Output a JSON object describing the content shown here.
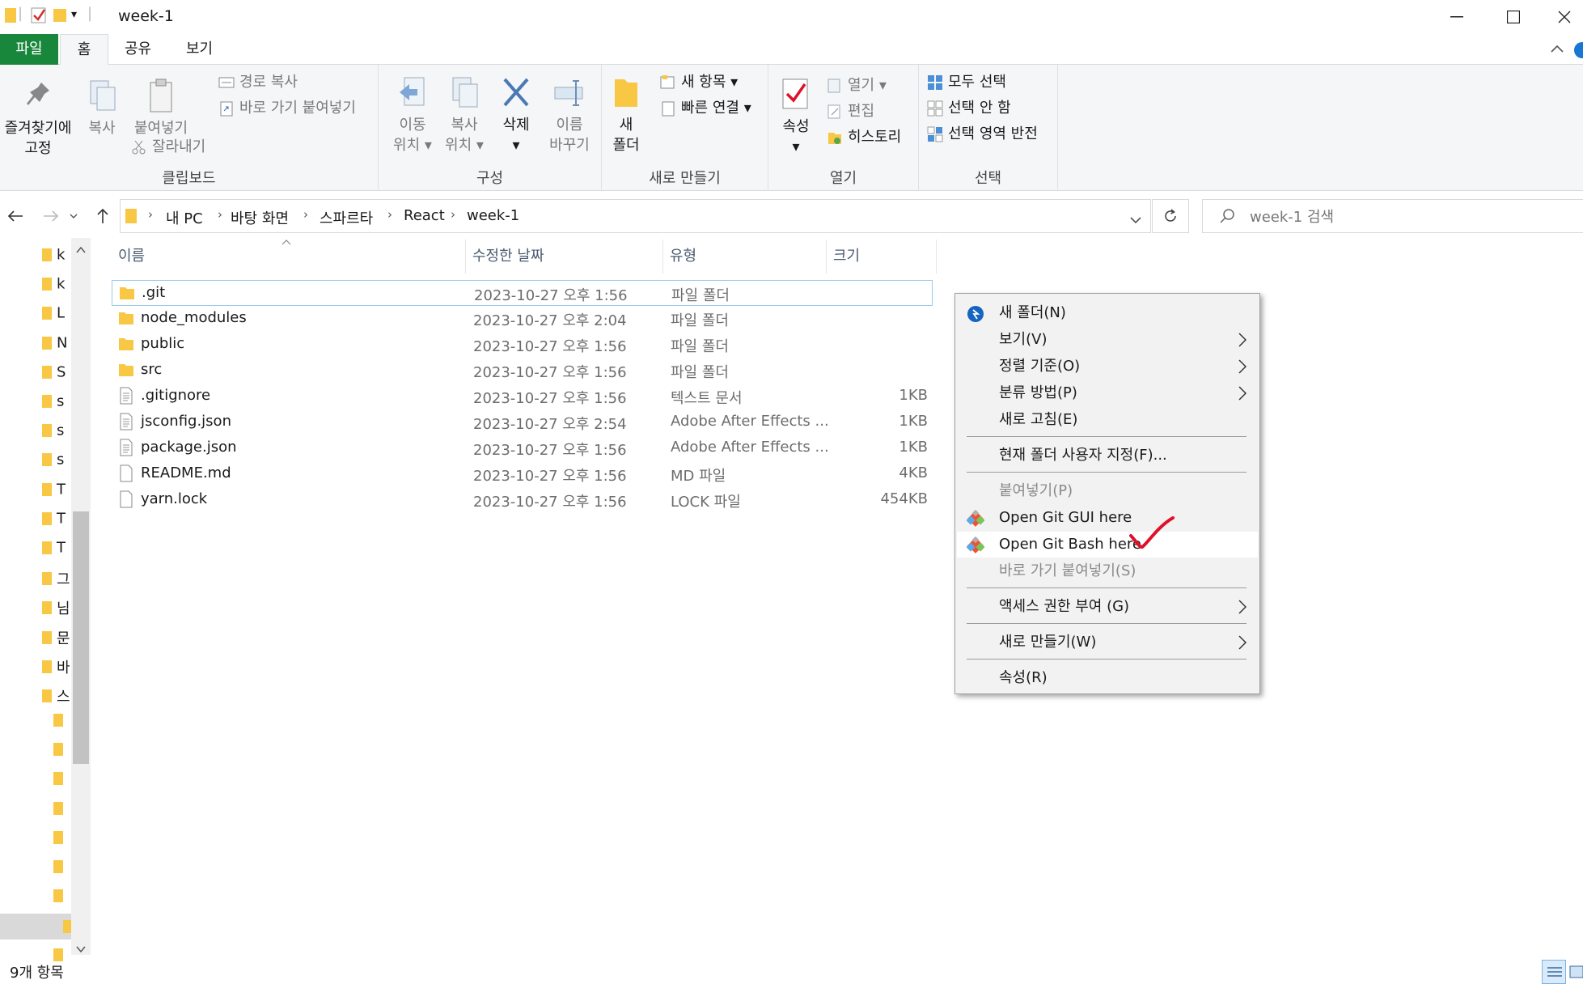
{
  "window": {
    "title": "week-1",
    "quick_access_chevron": "▾"
  },
  "ribbon_tabs": [
    "파일",
    "홈",
    "공유",
    "보기"
  ],
  "ribbon": {
    "clipboard": {
      "label": "클립보드",
      "pin_line1": "즐겨찾기에",
      "pin_line2": "고정",
      "copy": "복사",
      "paste": "붙여넣기",
      "copy_path": "경로 복사",
      "paste_shortcut": "바로 가기 붙여넣기",
      "cut": "잘라내기"
    },
    "organize": {
      "label": "구성",
      "move_line1": "이동",
      "move_line2": "위치",
      "copy_line1": "복사",
      "copy_line2": "위치",
      "delete": "삭제",
      "rename_line1": "이름",
      "rename_line2": "바꾸기"
    },
    "new": {
      "label": "새로 만들기",
      "new_folder_line1": "새",
      "new_folder_line2": "폴더",
      "new_item": "새 항목",
      "easy_access": "빠른 연결"
    },
    "open": {
      "label": "열기",
      "properties": "속성",
      "open": "열기",
      "edit": "편집",
      "history": "히스토리"
    },
    "select": {
      "label": "선택",
      "select_all": "모두 선택",
      "select_none": "선택 안 함",
      "invert": "선택 영역 반전"
    }
  },
  "address": {
    "crumbs": [
      "내 PC",
      "바탕 화면",
      "스파르타",
      "React",
      "week-1"
    ],
    "search_placeholder": "week-1 검색"
  },
  "nav_pane": {
    "items": [
      "k",
      "k",
      "L",
      "N",
      "S",
      "s",
      "s",
      "s",
      "T",
      "T",
      "T",
      "그",
      "님",
      "문",
      "바",
      "스"
    ]
  },
  "file_list": {
    "columns": [
      "이름",
      "수정한 날짜",
      "유형",
      "크기"
    ],
    "rows": [
      {
        "name": ".git",
        "date": "2023-10-27 오후 1:56",
        "type": "파일 폴더",
        "size": "",
        "kind": "folder"
      },
      {
        "name": "node_modules",
        "date": "2023-10-27 오후 2:04",
        "type": "파일 폴더",
        "size": "",
        "kind": "folder"
      },
      {
        "name": "public",
        "date": "2023-10-27 오후 1:56",
        "type": "파일 폴더",
        "size": "",
        "kind": "folder"
      },
      {
        "name": "src",
        "date": "2023-10-27 오후 1:56",
        "type": "파일 폴더",
        "size": "",
        "kind": "folder"
      },
      {
        "name": ".gitignore",
        "date": "2023-10-27 오후 1:56",
        "type": "텍스트 문서",
        "size": "1KB",
        "kind": "text"
      },
      {
        "name": "jsconfig.json",
        "date": "2023-10-27 오후 2:54",
        "type": "Adobe After Effects ...",
        "size": "1KB",
        "kind": "text"
      },
      {
        "name": "package.json",
        "date": "2023-10-27 오후 1:56",
        "type": "Adobe After Effects ...",
        "size": "1KB",
        "kind": "text"
      },
      {
        "name": "README.md",
        "date": "2023-10-27 오후 1:56",
        "type": "MD 파일",
        "size": "4KB",
        "kind": "file"
      },
      {
        "name": "yarn.lock",
        "date": "2023-10-27 오후 1:56",
        "type": "LOCK 파일",
        "size": "454KB",
        "kind": "file"
      }
    ]
  },
  "context_menu": {
    "items": [
      {
        "label": "새 폴더(N)",
        "icon": "new-folder-shortcut-icon",
        "arrow": false,
        "dim": false
      },
      {
        "label": "보기(V)",
        "arrow": true,
        "dim": false
      },
      {
        "label": "정렬 기준(O)",
        "arrow": true,
        "dim": false
      },
      {
        "label": "분류 방법(P)",
        "arrow": true,
        "dim": false
      },
      {
        "label": "새로 고침(E)",
        "arrow": false,
        "dim": false
      },
      {
        "label": "현재 폴더 사용자 지정(F)...",
        "arrow": false,
        "dim": false
      },
      {
        "label": "붙여넣기(P)",
        "arrow": false,
        "dim": true
      },
      {
        "label": "Open Git GUI here",
        "icon": "git-icon",
        "arrow": false,
        "dim": false
      },
      {
        "label": "Open Git Bash here",
        "icon": "git-icon",
        "arrow": false,
        "dim": false,
        "highlighted": true
      },
      {
        "label": "바로 가기 붙여넣기(S)",
        "arrow": false,
        "dim": true
      },
      {
        "label": "액세스 권한 부여 (G)",
        "arrow": true,
        "dim": false
      },
      {
        "label": "새로 만들기(W)",
        "arrow": true,
        "dim": false
      },
      {
        "label": "속성(R)",
        "arrow": false,
        "dim": false
      }
    ]
  },
  "status": {
    "item_count": "9개 항목"
  },
  "colors": {
    "file_tab": "#19873b",
    "folder": "#f8c845",
    "checkmark_annotation": "#e0102a",
    "git_red": "#f05033"
  }
}
